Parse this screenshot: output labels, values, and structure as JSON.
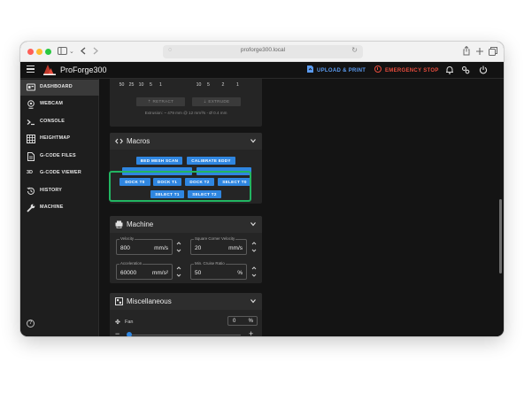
{
  "browser": {
    "url": "proforge300.local"
  },
  "app": {
    "title": "ProForge300",
    "upload_label": "UPLOAD & PRINT",
    "estop_label": "EMERGENCY STOP",
    "accent": "#2f86e0",
    "danger": "#e84c3d"
  },
  "sidebar": {
    "items": [
      {
        "label": "DASHBOARD",
        "icon": "dashboard-icon",
        "active": true
      },
      {
        "label": "WEBCAM",
        "icon": "webcam-icon"
      },
      {
        "label": "CONSOLE",
        "icon": "console-icon"
      },
      {
        "label": "HEIGHTMAP",
        "icon": "grid-icon"
      },
      {
        "label": "G-CODE FILES",
        "icon": "file-icon"
      },
      {
        "label": "G-CODE VIEWER",
        "icon": "3d-icon"
      },
      {
        "label": "HISTORY",
        "icon": "history-icon"
      },
      {
        "label": "MACHINE",
        "icon": "wrench-icon"
      }
    ],
    "viewer_glyph": "3D"
  },
  "extruder": {
    "distances_left": [
      "50",
      "25",
      "10",
      "5",
      "1"
    ],
    "distances_right": [
      "10",
      "5",
      "2",
      "1"
    ],
    "retract_label": "RETRACT",
    "extrude_label": "EXTRUDE",
    "info": "Extrusion: ~ 479 mm @ 12 mm³/s - Ø 0.4 mm"
  },
  "macros": {
    "title": "Macros",
    "row1": [
      "BED MESH SCAN",
      "CALIBRATE EDDY"
    ],
    "row_hidden": [
      "...",
      "..."
    ],
    "row2": [
      "DOCK T0",
      "DOCK T1",
      "DOCK T2",
      "SELECT T0"
    ],
    "row3": [
      "SELECT T1",
      "SELECT T2"
    ]
  },
  "machine": {
    "title": "Machine",
    "velocity": {
      "label": "Velocity",
      "value": "800",
      "unit": "mm/s"
    },
    "scv": {
      "label": "Square Corner Velocity",
      "value": "20",
      "unit": "mm/s"
    },
    "acceleration": {
      "label": "Acceleration",
      "value": "60000",
      "unit": "mm/s²"
    },
    "cruise": {
      "label": "Min. Cruise Ratio",
      "value": "50",
      "unit": "%"
    }
  },
  "misc": {
    "title": "Miscellaneous",
    "fan_label": "Fan",
    "fan_value": "0",
    "fan_unit": "%",
    "fan_level": 0
  }
}
